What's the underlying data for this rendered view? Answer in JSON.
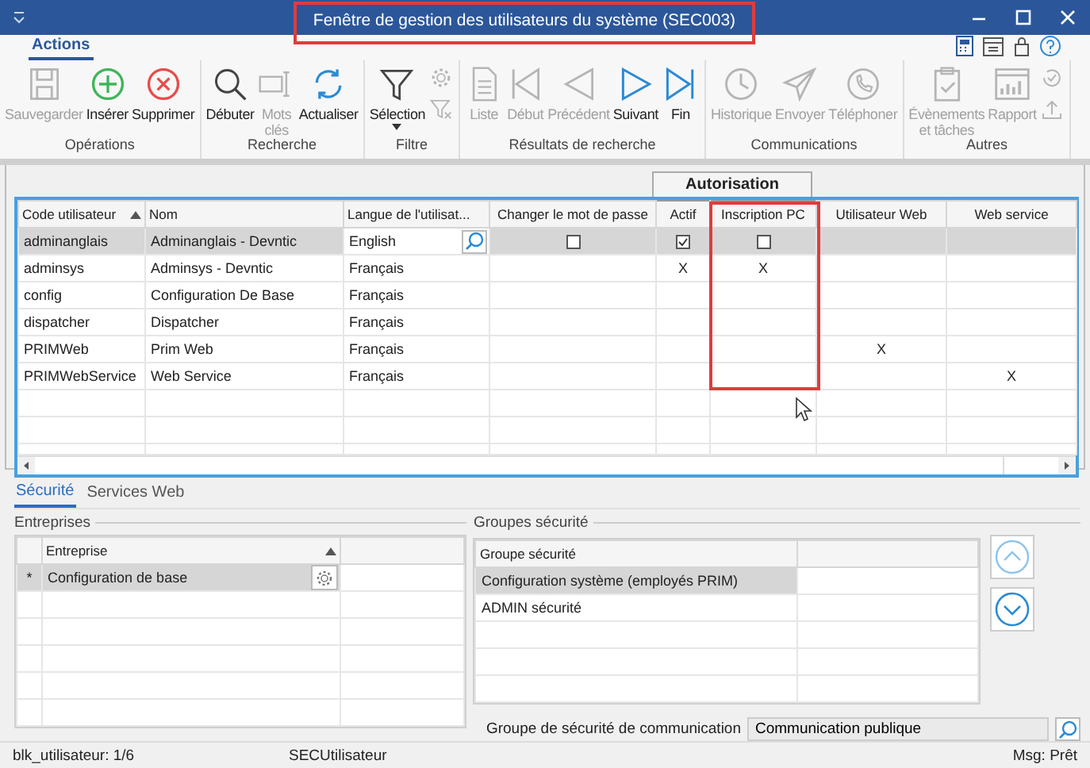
{
  "window": {
    "title": "Fenêtre de gestion des utilisateurs du système (SEC003)"
  },
  "ribbon_tabs": [
    {
      "label": "Actions",
      "selected": true
    }
  ],
  "ribbon": [
    {
      "label": "Opérations",
      "buttons": [
        {
          "kind": "save",
          "label": "Sauvegarder",
          "disabled": true
        },
        {
          "kind": "add",
          "label": "Insérer",
          "disabled": false
        },
        {
          "kind": "delete",
          "label": "Supprimer",
          "disabled": false
        }
      ]
    },
    {
      "label": "Recherche",
      "buttons": [
        {
          "kind": "search",
          "label": "Débuter",
          "disabled": false
        },
        {
          "kind": "keywords",
          "label": "Mots\nclés",
          "disabled": true
        },
        {
          "kind": "refresh",
          "label": "Actualiser",
          "disabled": false
        }
      ]
    },
    {
      "label": "Filtre",
      "buttons": [
        {
          "kind": "filter",
          "label": "Sélection",
          "disabled": false,
          "dropdown": true
        },
        {
          "kind": "gear",
          "disabled": true
        },
        {
          "kind": "clear_filter",
          "disabled": true
        }
      ]
    },
    {
      "label": "Résultats de recherche",
      "buttons": [
        {
          "kind": "list",
          "label": "Liste",
          "disabled": true
        },
        {
          "kind": "first",
          "label": "Début",
          "disabled": true
        },
        {
          "kind": "prev",
          "label": "Précédent",
          "disabled": true
        },
        {
          "kind": "next",
          "label": "Suivant",
          "disabled": false
        },
        {
          "kind": "last",
          "label": "Fin",
          "disabled": false
        }
      ]
    },
    {
      "label": "Communications",
      "buttons": [
        {
          "kind": "history",
          "label": "Historique",
          "disabled": true
        },
        {
          "kind": "send",
          "label": "Envoyer",
          "disabled": true
        },
        {
          "kind": "phone",
          "label": "Téléphoner",
          "disabled": true
        }
      ]
    },
    {
      "label": "Autres",
      "buttons": [
        {
          "kind": "events",
          "label": "Évènements\net tâches",
          "disabled": true
        },
        {
          "kind": "report",
          "label": "Rapport",
          "disabled": true
        },
        {
          "kind": "check",
          "disabled": true
        },
        {
          "kind": "upload",
          "disabled": true
        }
      ]
    }
  ],
  "users_grid": {
    "column_group": {
      "label": "Autorisation"
    },
    "columns": [
      {
        "label": "Code utilisateur",
        "sorted": true,
        "in_group": false
      },
      {
        "label": "Nom",
        "sorted": false,
        "in_group": false
      },
      {
        "label": "Langue de l'utilisat...",
        "sorted": false,
        "in_group": false
      },
      {
        "label": "Changer le mot de passe",
        "sorted": false,
        "in_group": false
      },
      {
        "label": "Actif",
        "sorted": false,
        "in_group": true
      },
      {
        "label": "Inscription  PC",
        "sorted": false,
        "in_group": true
      },
      {
        "label": "Utilisateur Web",
        "sorted": false,
        "in_group": false
      },
      {
        "label": "Web service",
        "sorted": false,
        "in_group": false
      }
    ],
    "rows": [
      {
        "selected": true,
        "cells": [
          {
            "kind": "text",
            "text": "adminanglais"
          },
          {
            "kind": "text",
            "text": "Adminanglais - Devntic"
          },
          {
            "kind": "lookup",
            "text": "English"
          },
          {
            "kind": "checkbox",
            "checked": false
          },
          {
            "kind": "checkbox",
            "checked": true
          },
          {
            "kind": "checkbox",
            "checked": false
          },
          {
            "kind": "empty"
          },
          {
            "kind": "empty"
          }
        ]
      },
      {
        "selected": false,
        "cells": [
          {
            "kind": "text",
            "text": "adminsys"
          },
          {
            "kind": "text",
            "text": "Adminsys - Devntic"
          },
          {
            "kind": "text",
            "text": "Français"
          },
          {
            "kind": "empty"
          },
          {
            "kind": "mark",
            "text": "X"
          },
          {
            "kind": "mark",
            "text": "X"
          },
          {
            "kind": "empty"
          },
          {
            "kind": "empty"
          }
        ]
      },
      {
        "selected": false,
        "cells": [
          {
            "kind": "text",
            "text": "config"
          },
          {
            "kind": "text",
            "text": "Configuration De Base"
          },
          {
            "kind": "text",
            "text": "Français"
          },
          {
            "kind": "empty"
          },
          {
            "kind": "empty"
          },
          {
            "kind": "empty"
          },
          {
            "kind": "empty"
          },
          {
            "kind": "empty"
          }
        ]
      },
      {
        "selected": false,
        "cells": [
          {
            "kind": "text",
            "text": "dispatcher"
          },
          {
            "kind": "text",
            "text": "Dispatcher"
          },
          {
            "kind": "text",
            "text": "Français"
          },
          {
            "kind": "empty"
          },
          {
            "kind": "empty"
          },
          {
            "kind": "empty"
          },
          {
            "kind": "empty"
          },
          {
            "kind": "empty"
          }
        ]
      },
      {
        "selected": false,
        "cells": [
          {
            "kind": "text",
            "text": "PRIMWeb"
          },
          {
            "kind": "text",
            "text": "Prim Web"
          },
          {
            "kind": "text",
            "text": "Français"
          },
          {
            "kind": "empty"
          },
          {
            "kind": "empty"
          },
          {
            "kind": "empty"
          },
          {
            "kind": "mark",
            "text": "X"
          },
          {
            "kind": "empty"
          }
        ]
      },
      {
        "selected": false,
        "cells": [
          {
            "kind": "text",
            "text": "PRIMWebService"
          },
          {
            "kind": "text",
            "text": "Web Service"
          },
          {
            "kind": "text",
            "text": "Français"
          },
          {
            "kind": "empty"
          },
          {
            "kind": "empty"
          },
          {
            "kind": "empty"
          },
          {
            "kind": "empty"
          },
          {
            "kind": "mark",
            "text": "X"
          }
        ]
      }
    ]
  },
  "detail_tabs": [
    {
      "label": "Sécurité",
      "selected": true
    },
    {
      "label": "Services Web",
      "selected": false
    }
  ],
  "entreprises": {
    "title": "Entreprises",
    "columns": [
      {
        "label": "Entreprise",
        "sorted": true
      }
    ],
    "rows": [
      {
        "selected": true,
        "marker": "*",
        "text": "Configuration de base"
      }
    ]
  },
  "groupes": {
    "title": "Groupes sécurité",
    "columns": [
      {
        "label": "Groupe sécurité"
      }
    ],
    "rows": [
      {
        "selected": true,
        "text": "Configuration système (employés PRIM)"
      },
      {
        "selected": false,
        "text": "ADMIN sécurité"
      }
    ],
    "communication": {
      "label": "Groupe de sécurité de communication",
      "value": "Communication publique"
    }
  },
  "status_bar": {
    "left": "blk_utilisateur: 1/6",
    "center": "SECUtilisateur",
    "right": "Msg: Prêt"
  }
}
